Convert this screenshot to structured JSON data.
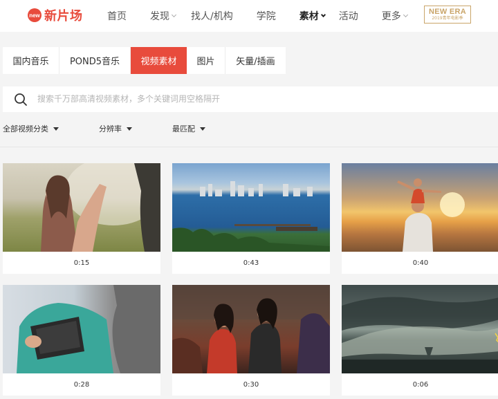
{
  "header": {
    "logo_badge": "new",
    "logo_text": "新片场",
    "nav": [
      {
        "label": "首页",
        "has_dropdown": false,
        "active": false
      },
      {
        "label": "发现",
        "has_dropdown": true,
        "active": false
      },
      {
        "label": "找人/机构",
        "has_dropdown": false,
        "active": false
      },
      {
        "label": "学院",
        "has_dropdown": false,
        "active": false
      },
      {
        "label": "素材",
        "has_dropdown": true,
        "active": true
      },
      {
        "label": "活动",
        "has_dropdown": false,
        "active": false
      },
      {
        "label": "更多",
        "has_dropdown": true,
        "active": false
      }
    ],
    "promo_line1": "NEW ERA",
    "promo_line2": "2019青年电影季"
  },
  "category_tabs": [
    {
      "label": "国内音乐",
      "active": false
    },
    {
      "label": "POND5音乐",
      "active": false
    },
    {
      "label": "视频素材",
      "active": true
    },
    {
      "label": "图片",
      "active": false
    },
    {
      "label": "矢量/插画",
      "active": false
    }
  ],
  "search": {
    "placeholder": "搜索千万部高清视频素材，多个关键词用空格隔开",
    "value": ""
  },
  "filters": [
    {
      "label": "全部视频分类"
    },
    {
      "label": "分辨率"
    },
    {
      "label": "最匹配"
    }
  ],
  "videos": [
    {
      "duration": "0:15",
      "thumb": "girl-in-field"
    },
    {
      "duration": "0:43",
      "thumb": "city-bay-skyline"
    },
    {
      "duration": "0:40",
      "thumb": "child-on-shoulders-beach-sunset"
    },
    {
      "duration": "0:28",
      "thumb": "nurse-with-tablet"
    },
    {
      "duration": "0:30",
      "thumb": "friends-laughing-at-bar"
    },
    {
      "duration": "0:06",
      "thumb": "storm-supercell"
    }
  ],
  "colors": {
    "accent": "#e84b3c",
    "promo_gold": "#c9a468",
    "background": "#f4f4f4"
  }
}
